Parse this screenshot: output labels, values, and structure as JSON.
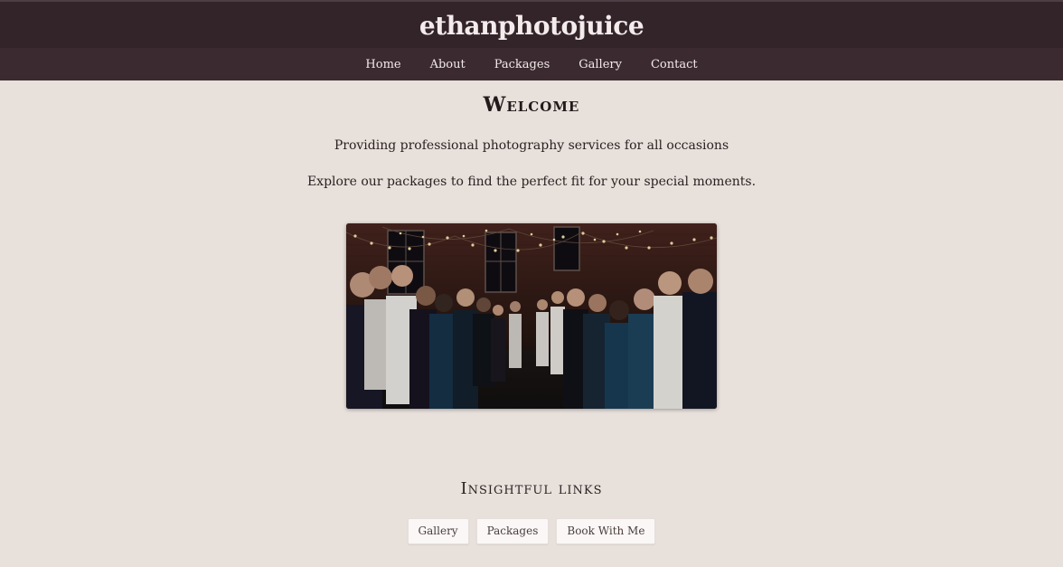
{
  "header": {
    "site_title": "ethanphotojuice"
  },
  "nav": {
    "items": [
      {
        "label": "Home"
      },
      {
        "label": "About"
      },
      {
        "label": "Packages"
      },
      {
        "label": "Gallery"
      },
      {
        "label": "Contact"
      }
    ]
  },
  "main": {
    "welcome": "Welcome",
    "tagline": "Providing professional photography services for all occasions",
    "explore": "Explore our packages to find the perfect fit for your special moments."
  },
  "links": {
    "heading": "Insightful links",
    "buttons": [
      {
        "label": "Gallery"
      },
      {
        "label": "Packages"
      },
      {
        "label": "Book With Me"
      }
    ]
  },
  "colors": {
    "header_bg": "#33242a",
    "nav_bg": "#3b2a30",
    "page_bg": "#e8e0db"
  }
}
